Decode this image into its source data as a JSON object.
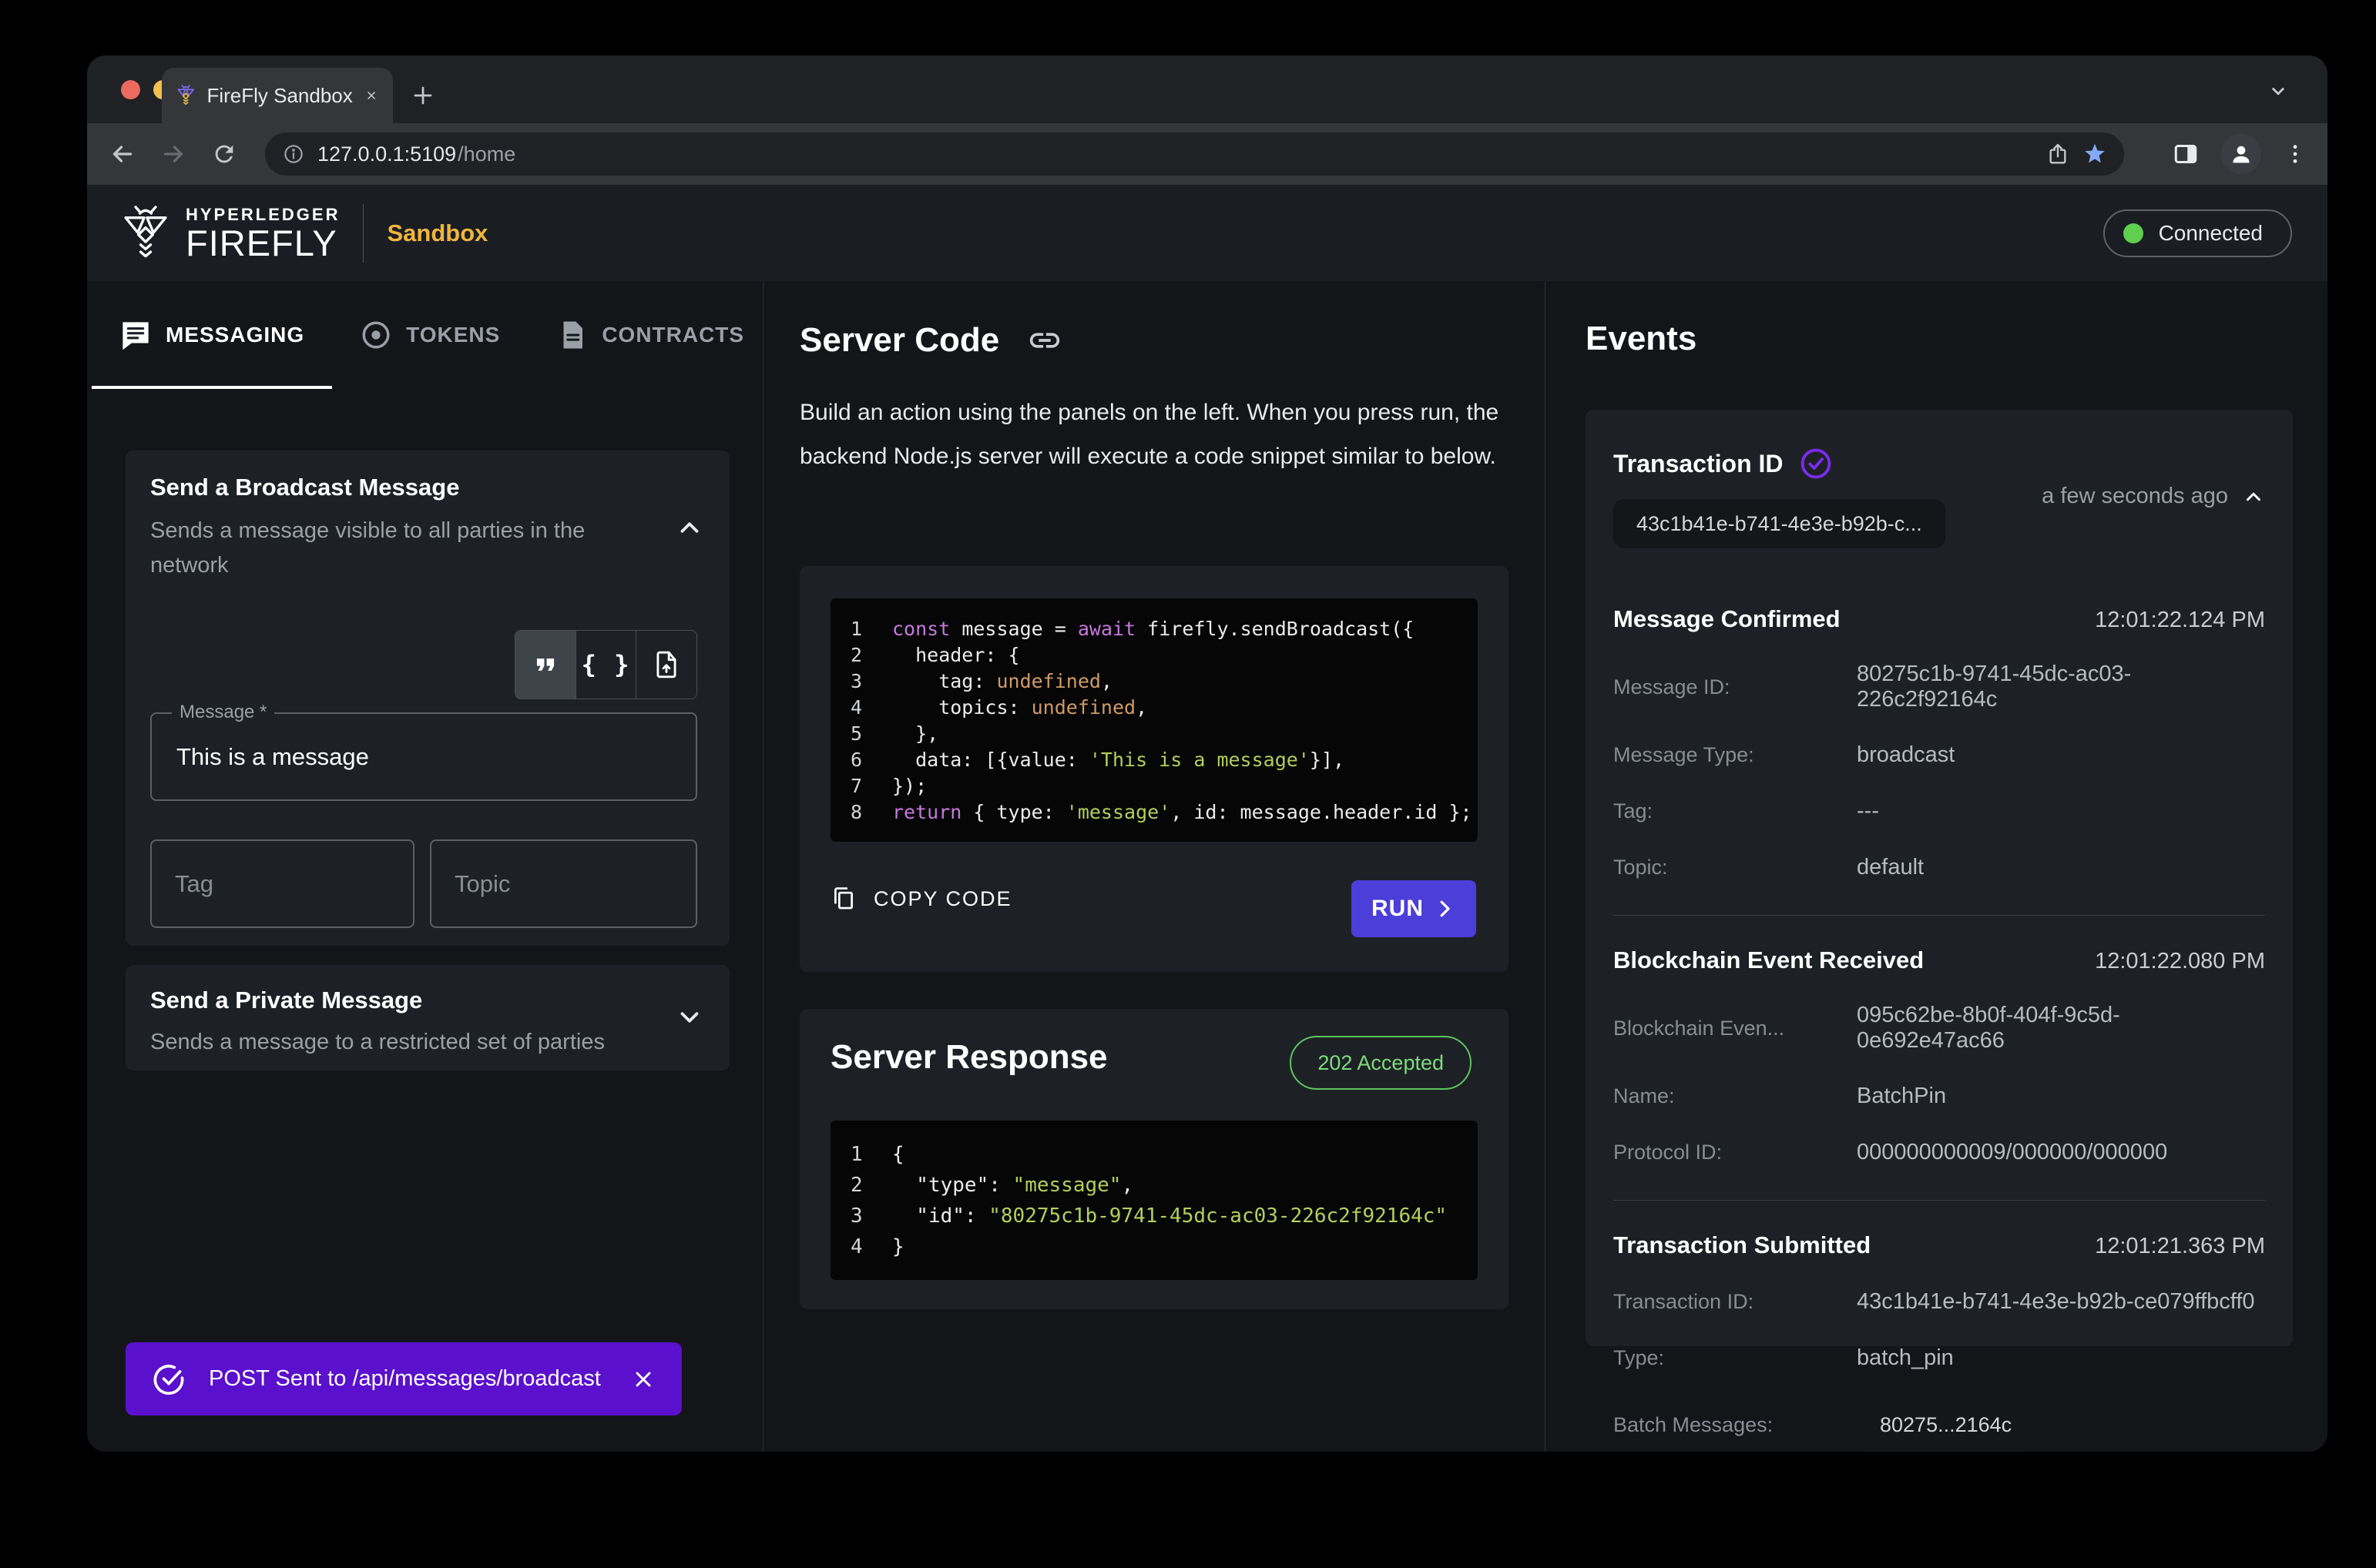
{
  "browser": {
    "tab_title": "FireFly Sandbox",
    "url_host": "127.0.0.1:5109",
    "url_path": "/home"
  },
  "header": {
    "brand_top": "HYPERLEDGER",
    "brand_name": "FIREFLY",
    "app_label": "Sandbox",
    "connection_status": "Connected"
  },
  "nav_tabs": [
    {
      "label": "MESSAGING"
    },
    {
      "label": "TOKENS"
    },
    {
      "label": "CONTRACTS"
    }
  ],
  "broadcast_card": {
    "title": "Send a Broadcast Message",
    "subtitle": "Sends a message visible to all parties in the network",
    "braces_glyph": "{ }",
    "message_label": "Message *",
    "message_value": "This is a message",
    "tag_label": "Tag",
    "topic_label": "Topic"
  },
  "private_card": {
    "title": "Send a Private Message",
    "subtitle": "Sends a message to a restricted set of parties"
  },
  "server_code": {
    "title": "Server Code",
    "description": "Build an action using the panels on the left. When you press run, the backend Node.js server will execute a code snippet similar to below.",
    "copy_label": "COPY CODE",
    "run_label": "RUN",
    "lines": [
      [
        [
          "k",
          "const"
        ],
        [
          "p",
          " message = "
        ],
        [
          "k",
          "await"
        ],
        [
          "p",
          " firefly.sendBroadcast({"
        ]
      ],
      [
        [
          "p",
          "  header: {"
        ]
      ],
      [
        [
          "p",
          "    tag: "
        ],
        [
          "o",
          "undefined"
        ],
        [
          "p",
          ","
        ]
      ],
      [
        [
          "p",
          "    topics: "
        ],
        [
          "o",
          "undefined"
        ],
        [
          "p",
          ","
        ]
      ],
      [
        [
          "p",
          "  },"
        ]
      ],
      [
        [
          "p",
          "  data: [{value: "
        ],
        [
          "s",
          "'This is a message'"
        ],
        [
          "p",
          "}],"
        ]
      ],
      [
        [
          "p",
          "});"
        ]
      ],
      [
        [
          "k",
          "return"
        ],
        [
          "p",
          " { type: "
        ],
        [
          "s",
          "'message'"
        ],
        [
          "p",
          ", id: message.header.id };"
        ]
      ]
    ]
  },
  "server_response": {
    "title": "Server Response",
    "status_badge": "202 Accepted",
    "lines": [
      [
        [
          "p",
          "{"
        ]
      ],
      [
        [
          "p",
          "  \"type\": "
        ],
        [
          "s",
          "\"message\""
        ],
        [
          "p",
          ","
        ]
      ],
      [
        [
          "p",
          "  \"id\": "
        ],
        [
          "s",
          "\"80275c1b-9741-45dc-ac03-226c2f92164c\""
        ]
      ],
      [
        [
          "p",
          "}"
        ]
      ]
    ]
  },
  "events": {
    "title": "Events",
    "group_title": "Transaction ID",
    "group_time": "a few seconds ago",
    "group_chip": "43c1b41e-b741-4e3e-b92b-c...",
    "sections": [
      {
        "title": "Message Confirmed",
        "time": "12:01:22.124 PM",
        "rows": [
          {
            "label": "Message ID:",
            "value": "80275c1b-9741-45dc-ac03-226c2f92164c"
          },
          {
            "label": "Message Type:",
            "value": "broadcast"
          },
          {
            "label": "Tag:",
            "value": "---"
          },
          {
            "label": "Topic:",
            "value": "default"
          }
        ]
      },
      {
        "title": "Blockchain Event Received",
        "time": "12:01:22.080 PM",
        "rows": [
          {
            "label": "Blockchain Even...",
            "value": "095c62be-8b0f-404f-9c5d-0e692e47ac66"
          },
          {
            "label": "Name:",
            "value": "BatchPin"
          },
          {
            "label": "Protocol ID:",
            "value": "000000000009/000000/000000"
          }
        ]
      },
      {
        "title": "Transaction Submitted",
        "time": "12:01:21.363 PM",
        "rows": [
          {
            "label": "Transaction ID:",
            "value": "43c1b41e-b741-4e3e-b92b-ce079ffbcff0"
          },
          {
            "label": "Type:",
            "value": "batch_pin"
          },
          {
            "label": "Batch Messages:",
            "value": "80275...2164c",
            "chip": true
          }
        ]
      }
    ]
  },
  "toast": {
    "message": "POST Sent to /api/messages/broadcast"
  },
  "colors": {
    "accent_purple": "#4c3ed9",
    "toast_purple": "#5a10cc",
    "check_purple": "#7c2bee",
    "gold": "#f0b53e",
    "green": "#5fc45f",
    "star_blue": "#82aaf7",
    "code_keyword": "#c678dd",
    "code_string": "#b5ce5c",
    "code_orange": "#d19a66"
  }
}
